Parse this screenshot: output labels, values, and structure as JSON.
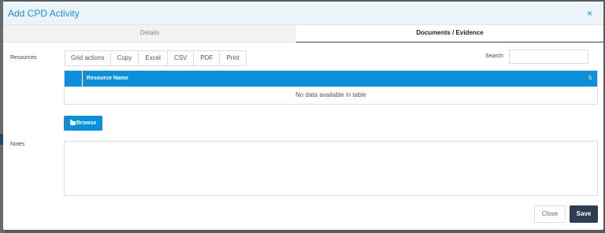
{
  "modal": {
    "title": "Add CPD Activity",
    "close_glyph": "×"
  },
  "tabs": [
    {
      "label": "Details",
      "active": false
    },
    {
      "label": "Documents / Evidence",
      "active": true
    }
  ],
  "resources": {
    "label": "Resources",
    "toolbar": [
      "Grid actions",
      "Copy",
      "Excel",
      "CSV",
      "PDF",
      "Print"
    ],
    "search_label": "Search:",
    "search_value": "",
    "table": {
      "columns": [
        "Resource Name"
      ],
      "empty_message": "No data available in table",
      "sort_icon": "sort-amount-icon"
    },
    "browse_label": "Browse"
  },
  "notes": {
    "label": "Notes",
    "value": ""
  },
  "footer": {
    "close_label": "Close",
    "save_label": "Save"
  },
  "colors": {
    "accent": "#0a8fd8",
    "title": "#1b8fd0",
    "save_bg": "#2c3e50"
  }
}
